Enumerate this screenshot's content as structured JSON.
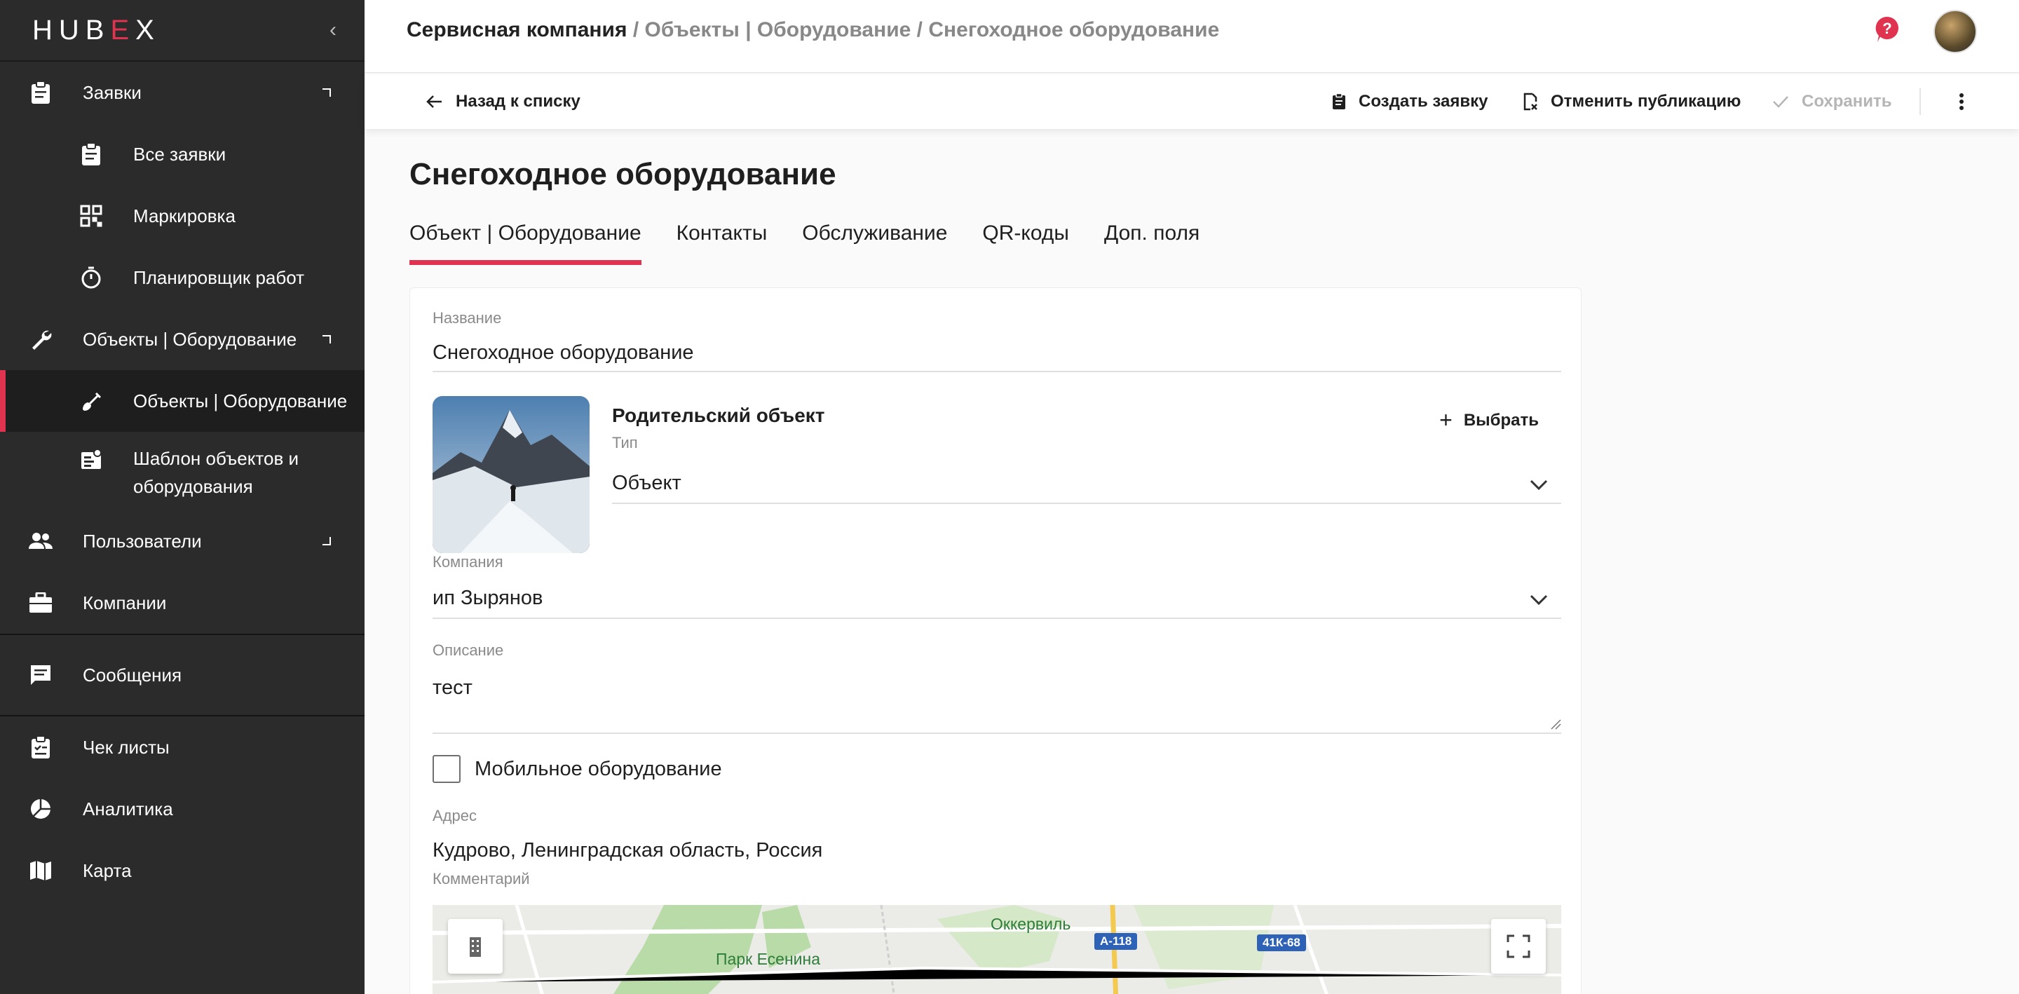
{
  "sidebar": {
    "logo": "HUBEX",
    "items": [
      {
        "label": "Заявки"
      },
      {
        "label": "Все заявки"
      },
      {
        "label": "Маркировка"
      },
      {
        "label": "Планировщик работ"
      },
      {
        "label": "Объекты | Оборудование"
      },
      {
        "label": "Объекты | Оборудование"
      },
      {
        "label": "Шаблон объектов и оборудования"
      },
      {
        "label": "Пользователи"
      },
      {
        "label": "Компании"
      },
      {
        "label": "Сообщения"
      },
      {
        "label": "Чек листы"
      },
      {
        "label": "Аналитика"
      },
      {
        "label": "Карта"
      }
    ]
  },
  "header": {
    "breadcrumb_root": "Сервисная компания",
    "breadcrumb_rest": " / Объекты | Оборудование / Снегоходное оборудование"
  },
  "toolbar": {
    "back_label": "Назад к списку",
    "create_label": "Создать заявку",
    "unpublish_label": "Отменить публикацию",
    "save_label": "Сохранить"
  },
  "page": {
    "title": "Снегоходное оборудование",
    "tabs": [
      {
        "label": "Объект | Оборудование"
      },
      {
        "label": "Контакты"
      },
      {
        "label": "Обслуживание"
      },
      {
        "label": "QR-коды"
      },
      {
        "label": "Доп. поля"
      }
    ]
  },
  "form": {
    "name_label": "Название",
    "name_value": "Снегоходное оборудование",
    "parent_title": "Родительский объект",
    "pick_label": "Выбрать",
    "type_label": "Тип",
    "type_value": "Объект",
    "company_label": "Компания",
    "company_value": "ип Зырянов",
    "description_label": "Описание",
    "description_value": "тест",
    "mobile_label": "Мобильное оборудование",
    "mobile_checked": false,
    "address_label": "Адрес",
    "address_value": "Кудрово, Ленинградская область, Россия",
    "comment_label": "Комментарий"
  },
  "map": {
    "labels": [
      "Оккервиль",
      "Парк Есенина"
    ],
    "road_badges": [
      "А-118",
      "41К-68"
    ]
  },
  "colors": {
    "accent": "#e0334f",
    "sidebar_bg": "#2b2b2b"
  }
}
